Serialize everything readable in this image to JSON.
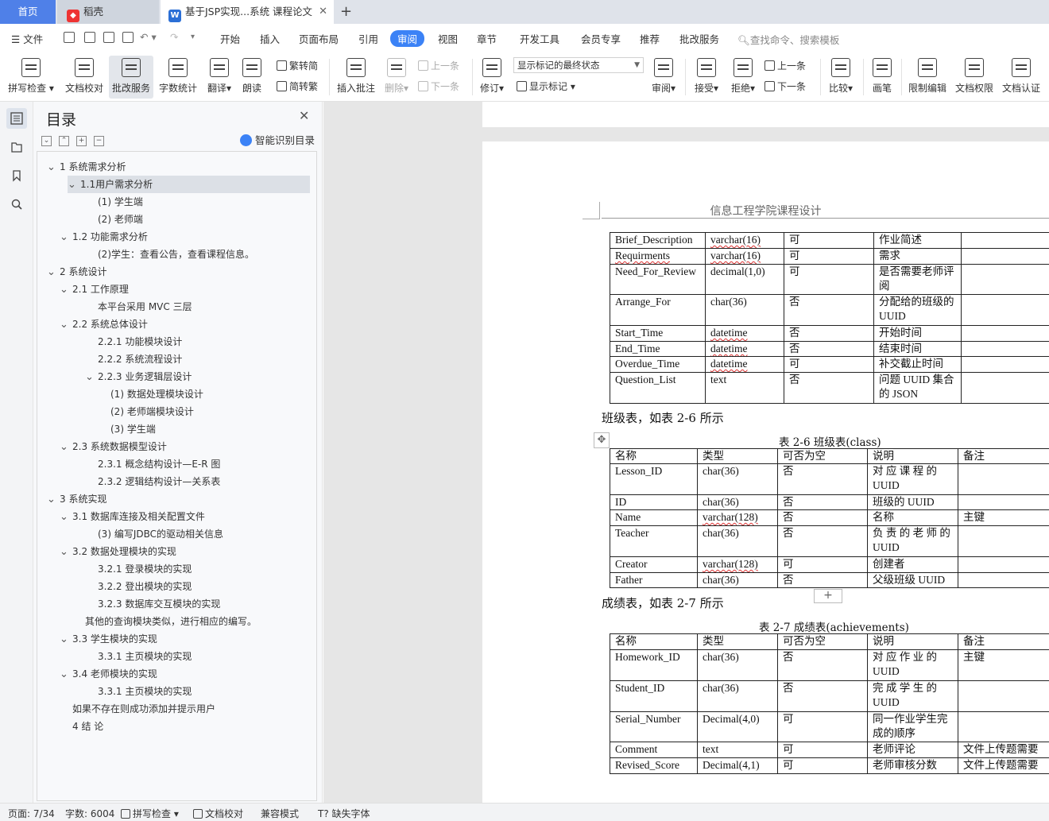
{
  "tabs": {
    "home": "首页",
    "daoke": "稻壳",
    "document": "基于JSP实现...系统 课程论文",
    "add": "+"
  },
  "menu": {
    "file": "文件",
    "items": [
      "开始",
      "插入",
      "页面布局",
      "引用",
      "审阅",
      "视图",
      "章节",
      "开发工具",
      "会员专享",
      "推荐",
      "批改服务"
    ],
    "active": "审阅",
    "search_placeholder": "查找命令、搜索模板"
  },
  "ribbon": {
    "spellcheck": "拼写检查",
    "proofread": "文档校对",
    "correction_service": "批改服务",
    "word_count": "字数统计",
    "translate": "翻译",
    "read_aloud": "朗读",
    "trad_to_simp": "繁转简",
    "simp_to_trad": "简转繁",
    "insert_comment": "插入批注",
    "delete": "删除",
    "prev_comment": "上一条",
    "next_comment": "下一条",
    "track_changes": "修订",
    "markup_mode": "显示标记的最终状态",
    "show_markup": "显示标记",
    "review": "审阅",
    "accept": "接受",
    "reject": "拒绝",
    "prev_change": "上一条",
    "next_change": "下一条",
    "compare": "比较",
    "pen": "画笔",
    "restrict_edit": "限制编辑",
    "doc_permission": "文档权限",
    "doc_cert": "文档认证"
  },
  "toc": {
    "title": "目录",
    "smart_detect": "智能识别目录",
    "items": [
      {
        "text": "1  系统需求分析",
        "level": 0,
        "chev": "down"
      },
      {
        "text": "1.1用户需求分析",
        "level": 1,
        "chev": "down",
        "selected": true
      },
      {
        "text": "(1)  学生端",
        "level": 2
      },
      {
        "text": "(2)  老师端",
        "level": 2
      },
      {
        "text": "1.2  功能需求分析",
        "level": 1,
        "chev": "down"
      },
      {
        "text": "(2)学生：查看公告，查看课程信息。",
        "level": 2
      },
      {
        "text": "2  系统设计",
        "level": 0,
        "chev": "down"
      },
      {
        "text": "2.1 工作原理",
        "level": 1,
        "chev": "down"
      },
      {
        "text": "本平台采用 MVC 三层",
        "level": 2
      },
      {
        "text": "2.2  系统总体设计",
        "level": 1,
        "chev": "down"
      },
      {
        "text": "2.2.1  功能模块设计",
        "level": 2
      },
      {
        "text": "2.2.2  系统流程设计",
        "level": 2
      },
      {
        "text": "2.2.3  业务逻辑层设计",
        "level": 2,
        "chev": "down"
      },
      {
        "text": "(1)  数据处理模块设计",
        "level": 3
      },
      {
        "text": "(2)  老师端模块设计",
        "level": 3
      },
      {
        "text": "(3)  学生端",
        "level": 3
      },
      {
        "text": "2.3  系统数据模型设计",
        "level": 1,
        "chev": "down"
      },
      {
        "text": "2.3.1  概念结构设计—E-R 图",
        "level": 2
      },
      {
        "text": "2.3.2  逻辑结构设计—关系表",
        "level": 2
      },
      {
        "text": "3  系统实现",
        "level": 0,
        "chev": "down"
      },
      {
        "text": "3.1  数据库连接及相关配置文件",
        "level": 1,
        "chev": "down"
      },
      {
        "text": "(3)  编写JDBC的驱动相关信息",
        "level": 2
      },
      {
        "text": "3.2  数据处理模块的实现",
        "level": 1,
        "chev": "down"
      },
      {
        "text": "3.2.1 登录模块的实现",
        "level": 2
      },
      {
        "text": "3.2.2 登出模块的实现",
        "level": 2
      },
      {
        "text": "3.2.3 数据库交互模块的实现",
        "level": 2
      },
      {
        "text": "其他的查询模块类似，进行相应的编写。",
        "level": 1.5
      },
      {
        "text": "3.3  学生模块的实现",
        "level": 1,
        "chev": "down"
      },
      {
        "text": "3.3.1 主页模块的实现",
        "level": 2
      },
      {
        "text": "3.4  老师模块的实现",
        "level": 1,
        "chev": "down"
      },
      {
        "text": "3.3.1 主页模块的实现",
        "level": 2
      },
      {
        "text": "如果不存在则成功添加并提示用户",
        "level": 0.5
      },
      {
        "text": "4  结  论",
        "level": 0.5
      }
    ]
  },
  "document": {
    "running_header": "信息工程学院课程设计",
    "table_homework": [
      [
        "Brief_Description",
        "varchar(16)",
        "可",
        "作业简述",
        ""
      ],
      [
        "Requirments",
        "varchar(16)",
        "可",
        "需求",
        ""
      ],
      [
        "Need_For_Review",
        "decimal(1,0)",
        "可",
        "是否需要老师评阅",
        ""
      ],
      [
        "Arrange_For",
        "char(36)",
        "否",
        "分配给的班级的 UUID",
        ""
      ],
      [
        "Start_Time",
        "datetime",
        "否",
        "开始时间",
        ""
      ],
      [
        "End_Time",
        "datetime",
        "否",
        "结束时间",
        ""
      ],
      [
        "Overdue_Time",
        "datetime",
        "可",
        "补交截止时间",
        ""
      ],
      [
        "Question_List",
        "text",
        "否",
        "问题 UUID 集合的 JSON",
        ""
      ]
    ],
    "para_class": "班级表，如表 2-6 所示",
    "caption_class": "表 2-6  班级表(class)",
    "table_class": [
      [
        "名称",
        "类型",
        "可否为空",
        "说明",
        "备注"
      ],
      [
        "Lesson_ID",
        "char(36)",
        "否",
        "对 应 课 程 的 UUID",
        ""
      ],
      [
        "ID",
        "char(36)",
        "否",
        "班级的 UUID",
        ""
      ],
      [
        "Name",
        "varchar(128)",
        "否",
        "名称",
        "主键"
      ],
      [
        "Teacher",
        "char(36)",
        "否",
        "负 责 的 老 师 的 UUID",
        ""
      ],
      [
        "Creator",
        "varchar(128)",
        "可",
        "创建者",
        ""
      ],
      [
        "Father",
        "char(36)",
        "否",
        "父级班级 UUID",
        ""
      ]
    ],
    "para_achievements": "成绩表，如表 2-7 所示",
    "caption_achievements": "表 2-7  成绩表(achievements)",
    "table_achievements": [
      [
        "名称",
        "类型",
        "可否为空",
        "说明",
        "备注"
      ],
      [
        "Homework_ID",
        "char(36)",
        "否",
        "对 应 作 业 的 UUID",
        "主键"
      ],
      [
        "Student_ID",
        "char(36)",
        "否",
        "完 成 学 生 的 UUID",
        ""
      ],
      [
        "Serial_Number",
        "Decimal(4,0)",
        "可",
        "同一作业学生完成的顺序",
        ""
      ],
      [
        "Comment",
        "text",
        "可",
        "老师评论",
        "文件上传题需要"
      ],
      [
        "Revised_Score",
        "Decimal(4,1)",
        "可",
        "老师审核分数",
        "文件上传题需要"
      ]
    ]
  },
  "status": {
    "page": "页面: 7/34",
    "words": "字数: 6004",
    "spellcheck": "拼写检查",
    "proofread": "文档校对",
    "compat": "兼容模式",
    "missing_font": "缺失字体"
  }
}
